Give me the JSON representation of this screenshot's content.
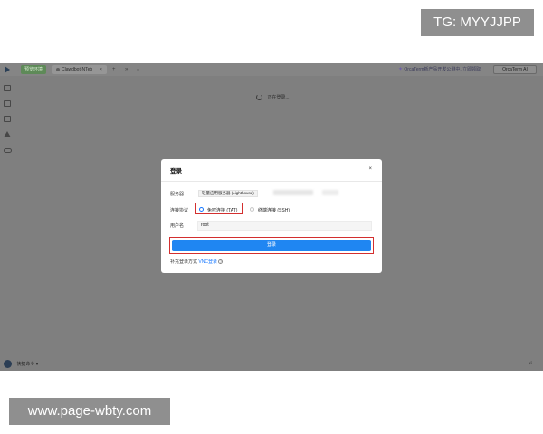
{
  "overlays": {
    "tg_badge": "TG: MYYJJPP",
    "watermark": "www.page-wbty.com"
  },
  "topbar": {
    "env_badge": "预览环境",
    "tab_label": "Clawdbot-NTeb",
    "tab_close": "×",
    "notice_text": "OrcaTerm新产品开发公测中, 立即领取",
    "notice_link": "",
    "orca_button": "OrcaTerm AI"
  },
  "main": {
    "loading_text": "正在登录..."
  },
  "bottom": {
    "shortcut_label": "快捷命令 ▾"
  },
  "dialog": {
    "title": "登录",
    "close": "×",
    "server_label": "服务器",
    "server_value": "轻量应用服务器 (Lighthouse)",
    "protocol_label": "连接协议",
    "option_tat": "免密连接 (TAT)",
    "option_ssh": "终端连接 (SSH)",
    "username_label": "用户名",
    "username_value": "root",
    "login_button": "登录",
    "extra_label": "补充登录方式",
    "extra_link": "VNC登录",
    "selected_protocol": "免密连接 (TAT)"
  },
  "colors": {
    "accent": "#1f86f2",
    "highlight_box": "#d32f2f",
    "overlay": "#7f7f7f"
  },
  "icons": [
    "logo-icon",
    "chevron-down-icon",
    "chevron-double-icon",
    "users-icon",
    "file-icon",
    "image-icon",
    "home-icon",
    "cloud-icon",
    "spinner-icon",
    "bell-icon",
    "help-icon",
    "close-icon"
  ]
}
